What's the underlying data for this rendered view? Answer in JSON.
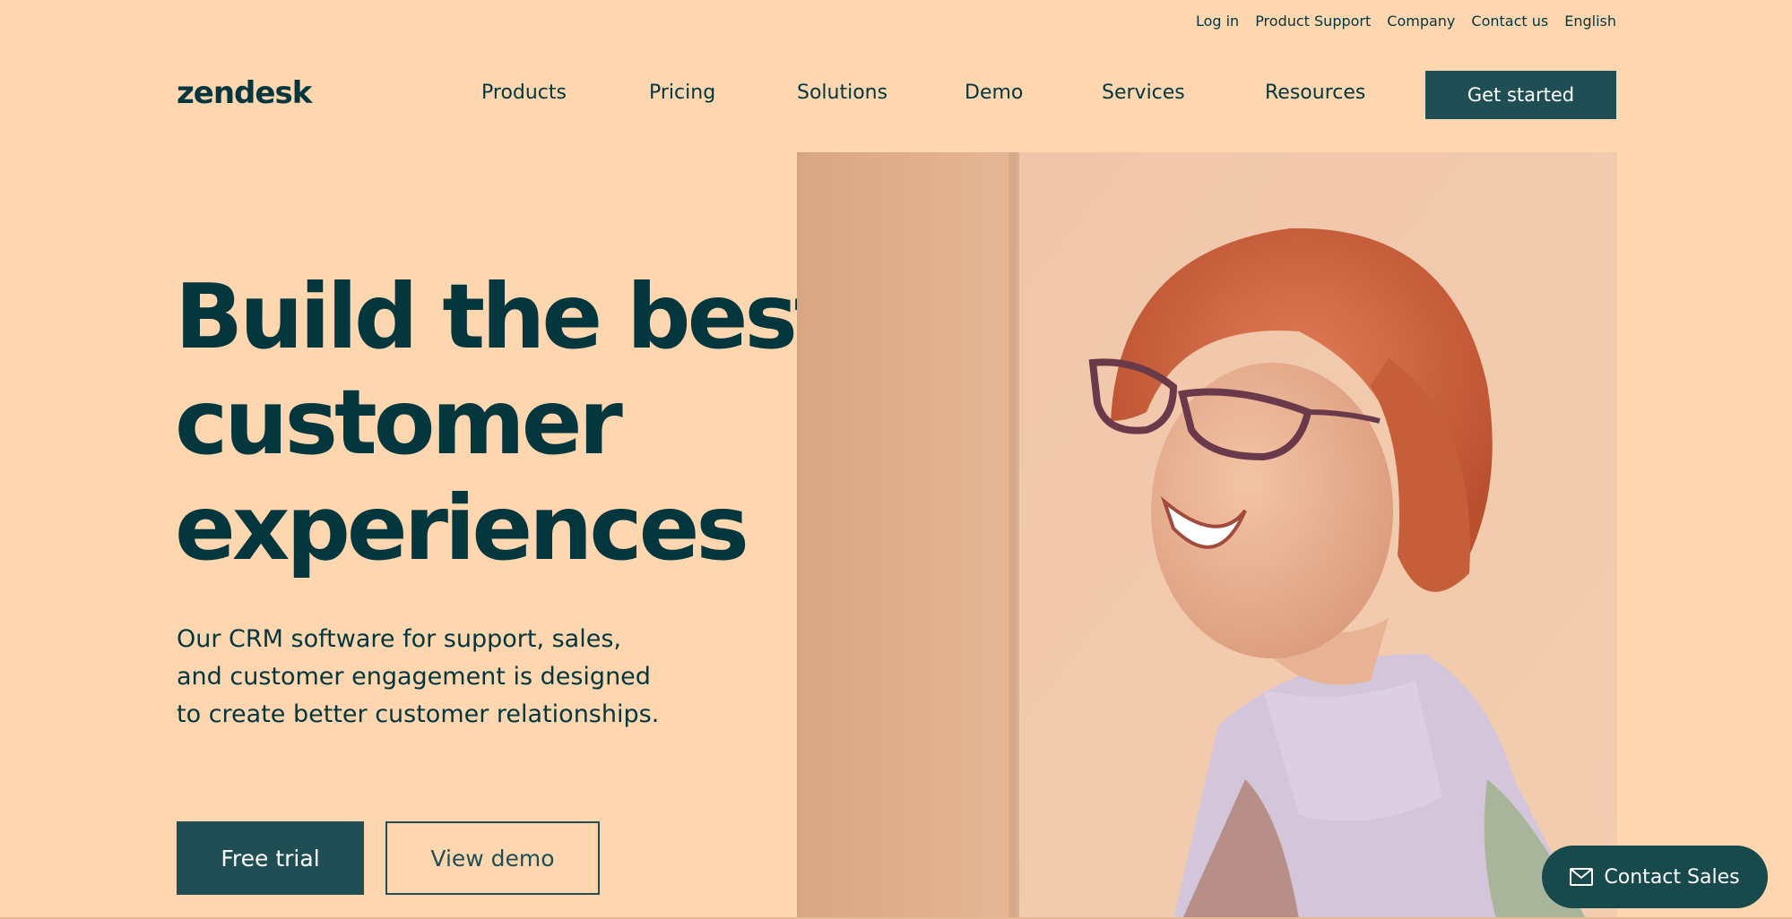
{
  "utility_nav": {
    "login": "Log in",
    "product_support": "Product Support",
    "company": "Company",
    "contact_us": "Contact us",
    "language": "English"
  },
  "brand": {
    "logo": "zendesk"
  },
  "main_nav": {
    "products": "Products",
    "pricing": "Pricing",
    "solutions": "Solutions",
    "demo": "Demo",
    "services": "Services",
    "resources": "Resources",
    "cta": "Get started"
  },
  "hero": {
    "title_line1": "Build the best",
    "title_line2": "customer",
    "title_line3": "experiences",
    "subtitle": "Our CRM software for support, sales, and customer engagement is designed to create better customer relationships.",
    "primary_button": "Free trial",
    "secondary_button": "View demo"
  },
  "chat": {
    "label": "Contact Sales",
    "icon": "mail-icon"
  },
  "colors": {
    "background": "#fed6b0",
    "text": "#03363d",
    "button": "#1f4f54",
    "chat_button": "#17494d"
  }
}
